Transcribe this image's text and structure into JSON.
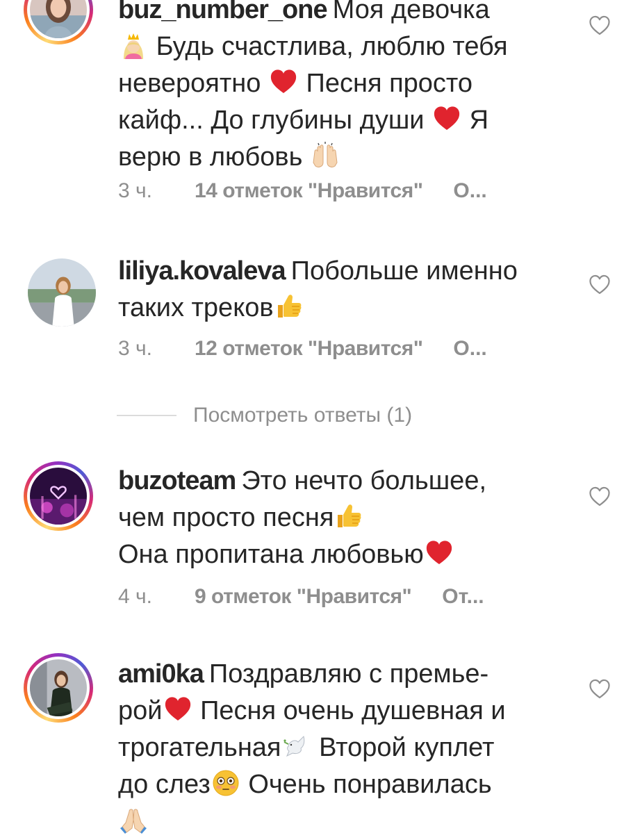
{
  "comments": [
    {
      "username": "buz_number_one",
      "parts": [
        "Моя девочка",
        "Будь счастлива, люблю тебя",
        "невероятно",
        "Песня просто",
        "кайф... До глубины души",
        "Я",
        "верю в любовь"
      ],
      "time": "3 ч.",
      "likes": "14 отметок \"Нравится\"",
      "reply": "О..."
    },
    {
      "username": "liliya.kovaleva",
      "parts": [
        "Побольше именно",
        "таких  треков"
      ],
      "time": "3 ч.",
      "likes": "12 отметок \"Нравится\"",
      "reply": "О..."
    },
    {
      "username": "buzoteam",
      "parts": [
        "Это нечто большее,",
        "чем просто песня",
        "Она пропитана любовью"
      ],
      "time": "4 ч.",
      "likes": "9 отметок \"Нравится\"",
      "reply": "От..."
    },
    {
      "username": "ami0ka",
      "parts": [
        "Поздравляю с премье-",
        "рой",
        "Песня очень душевная и",
        "трогательная",
        "Второй куплет",
        "до слез",
        "Очень понравилась"
      ]
    }
  ],
  "view_replies": "Посмотреть ответы (1)",
  "icons": {
    "like": "heart-outline-icon",
    "emoji_princess": "princess-emoji",
    "emoji_heart": "red-heart-emoji",
    "emoji_raised_hands": "raised-hands-emoji",
    "emoji_thumbs_up": "thumbs-up-emoji",
    "emoji_dove": "dove-emoji",
    "emoji_flushed": "flushed-face-emoji",
    "emoji_pray": "folded-hands-emoji"
  },
  "colors": {
    "text": "#262626",
    "secondary": "#8e8e8e",
    "heart": "#e0242e"
  }
}
